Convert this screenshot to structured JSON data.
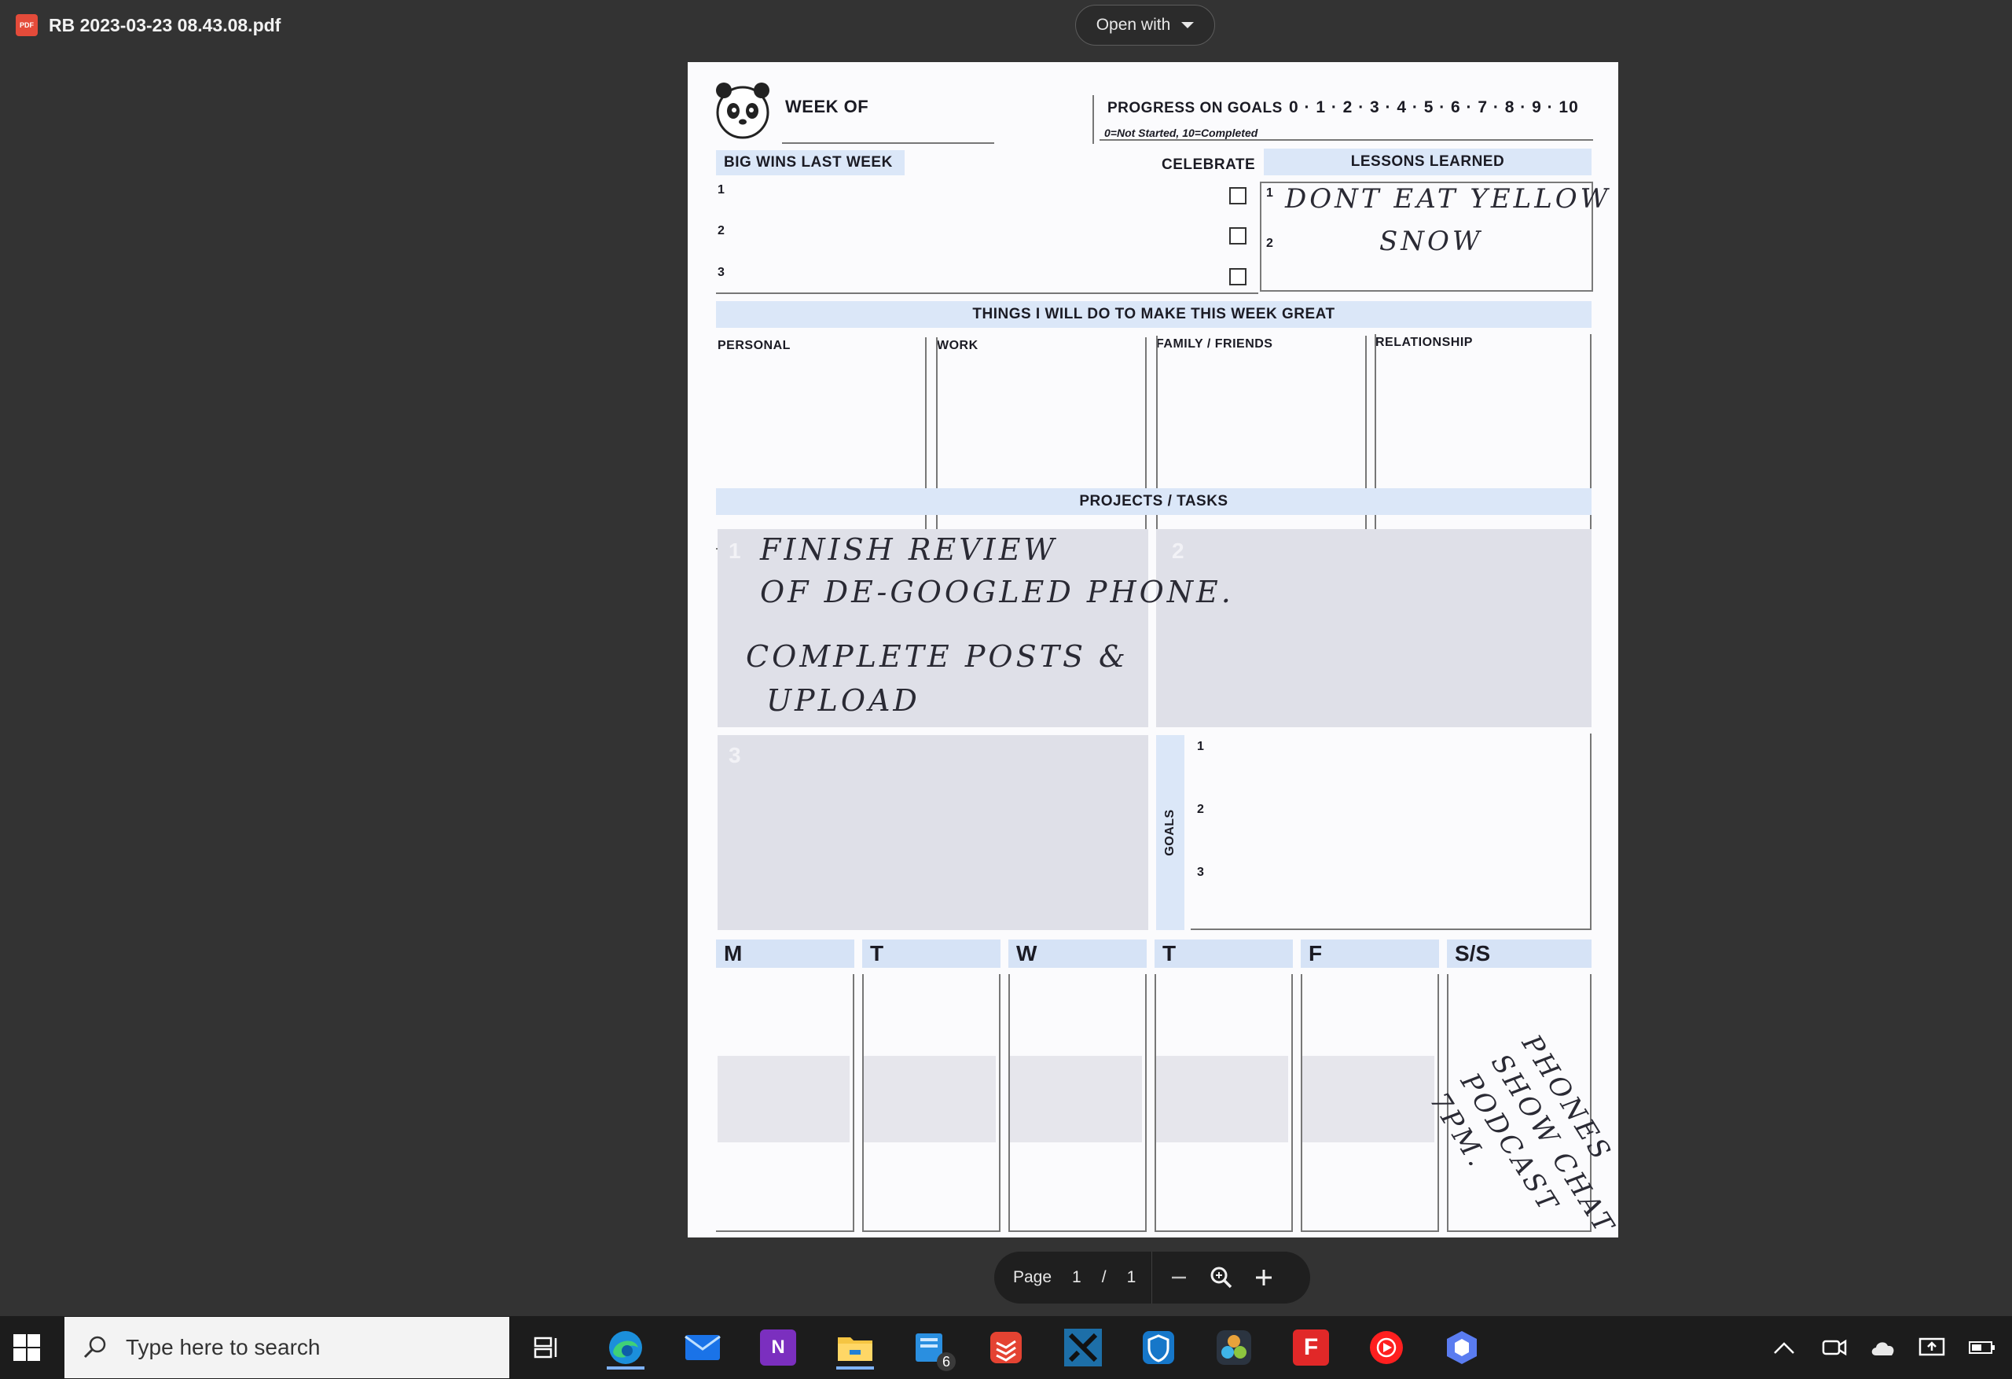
{
  "viewer": {
    "file_icon": "pdf-icon",
    "file_icon_text": "PDF",
    "file_name": "RB 2023-03-23 08.43.08.pdf",
    "open_with_label": "Open with",
    "pager": {
      "page_label": "Page",
      "current_page": "1",
      "separator": "/",
      "total_pages": "1",
      "zoom_out_icon": "minus-icon",
      "zoom_fit_icon": "magnifier-icon",
      "zoom_in_icon": "plus-icon"
    }
  },
  "planner": {
    "week_of": "WEEK OF",
    "progress_title": "PROGRESS ON GOALS",
    "progress_scale": "0 · 1 · 2 · 3 · 4 · 5 · 6 · 7 · 8 · 9 · 10",
    "progress_note": "0=Not Started, 10=Completed",
    "big_wins_title": "BIG WINS LAST WEEK",
    "celebrate_title": "CELEBRATE",
    "lessons_title": "LESSONS LEARNED",
    "wins_numbers": [
      "1",
      "2",
      "3"
    ],
    "lesson_numbers": [
      "1",
      "2"
    ],
    "lesson_handwriting": [
      "DONT EAT YELLOW",
      "SNOW"
    ],
    "things_title": "THINGS I WILL DO TO MAKE THIS WEEK GREAT",
    "categories": [
      "PERSONAL",
      "WORK",
      "FAMILY / FRIENDS",
      "RELATIONSHIP"
    ],
    "projects_title": "PROJECTS / TASKS",
    "project_numbers": [
      "1",
      "2",
      "3"
    ],
    "project1_handwriting": [
      "FINISH REVIEW",
      "OF DE-GOOGLED PHONE.",
      "COMPLETE POSTS &",
      "UPLOAD"
    ],
    "goals_label": "GOALS",
    "goal_numbers": [
      "1",
      "2",
      "3"
    ],
    "days": [
      "M",
      "T",
      "W",
      "T",
      "F",
      "S/S"
    ],
    "weekend_handwriting": "PHONES SHOW CHAT PODCAST 7PM."
  },
  "taskbar": {
    "start_icon": "windows-start-icon",
    "search_placeholder": "Type here to search",
    "search_icon": "search-icon",
    "apps": [
      {
        "name": "task-view",
        "icon": "task-view-icon"
      },
      {
        "name": "edge",
        "icon": "edge-icon"
      },
      {
        "name": "mail",
        "icon": "mail-icon"
      },
      {
        "name": "onenote",
        "icon": "onenote-icon",
        "text": "N"
      },
      {
        "name": "file-explorer",
        "icon": "folder-icon"
      },
      {
        "name": "notes",
        "icon": "notes-icon",
        "badge": "6"
      },
      {
        "name": "todoist",
        "icon": "todoist-icon"
      },
      {
        "name": "app-x",
        "icon": "x-app-icon"
      },
      {
        "name": "defender",
        "icon": "shield-icon"
      },
      {
        "name": "davinci",
        "icon": "davinci-icon"
      },
      {
        "name": "flipboard",
        "icon": "flipboard-icon",
        "text": "F"
      },
      {
        "name": "youtube-music",
        "icon": "youtube-music-icon"
      },
      {
        "name": "app-hex",
        "icon": "hexagon-app-icon"
      }
    ],
    "tray_icons": [
      "chevron-up-icon",
      "meet-now-icon",
      "onedrive-cloud-icon",
      "display-icon",
      "battery-icon"
    ]
  },
  "colors": {
    "background": "#333333",
    "taskbar": "#1c1c1c",
    "planner_blue": "#dbe7f8",
    "active_indicator": "#7fb3ff"
  }
}
